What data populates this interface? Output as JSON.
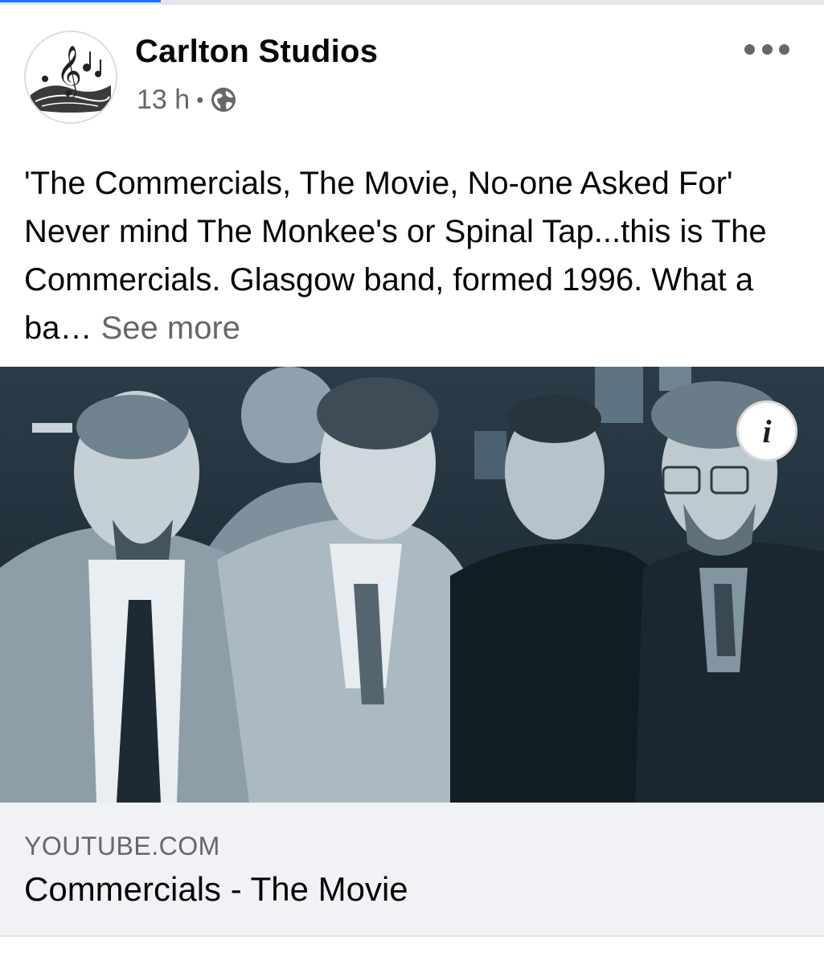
{
  "post": {
    "author": "Carlton Studios",
    "time": "13 h",
    "separator": "•",
    "audience_icon": "globe-icon",
    "menu_icon": "more-options-icon",
    "text": "'The Commercials, The Movie, No-one Asked For'  Never mind The Monkee's or Spinal Tap...this is The Commercials.  Glasgow band, formed 1996. What a ba…",
    "see_more_label": "See more"
  },
  "media": {
    "info_glyph": "i",
    "info_icon": "info-icon"
  },
  "link_preview": {
    "domain": "YOUTUBE.COM",
    "title": "Commercials - The Movie"
  },
  "colors": {
    "primary_text": "#050505",
    "secondary_text": "#65676b",
    "preview_background": "#f0f2f5"
  }
}
